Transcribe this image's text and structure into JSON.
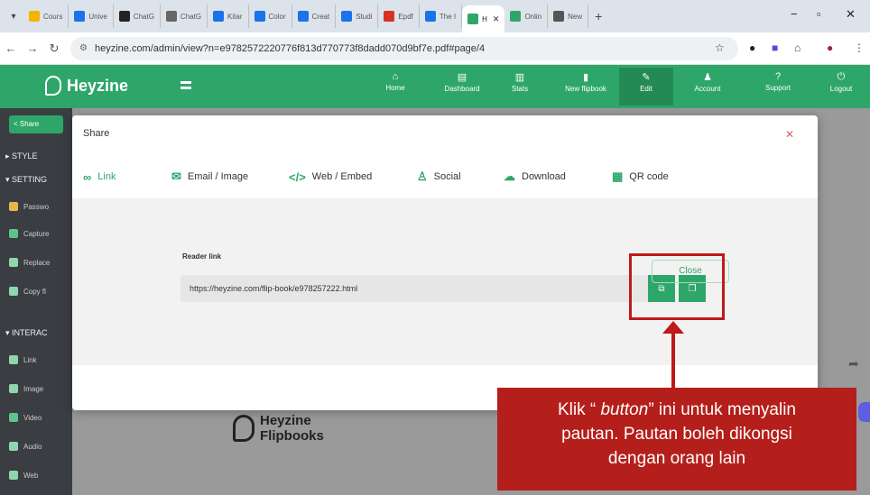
{
  "browser": {
    "tabs": [
      {
        "label": "Cours",
        "color": "#f4b400"
      },
      {
        "label": "Unive",
        "color": "#1a73e8"
      },
      {
        "label": "ChatG",
        "color": "#222222"
      },
      {
        "label": "ChatG",
        "color": "#666666"
      },
      {
        "label": "Kitar",
        "color": "#1a73e8"
      },
      {
        "label": "Color",
        "color": "#1a73e8"
      },
      {
        "label": "Creat",
        "color": "#1a73e8"
      },
      {
        "label": "Studi",
        "color": "#1a73e8"
      },
      {
        "label": "Epdf",
        "color": "#d93025"
      },
      {
        "label": "The I",
        "color": "#1a73e8"
      },
      {
        "label": "H",
        "color": "#2ea66a",
        "active": true
      },
      {
        "label": "Onlin",
        "color": "#2ea66a"
      },
      {
        "label": "New",
        "color": "#555555"
      }
    ],
    "url": "heyzine.com/admin/view?n=e9782572220776f813d770773f8dadd070d9bf7e.pdf#page/4"
  },
  "app": {
    "brand": "Heyzine",
    "nav": [
      {
        "label": "Home",
        "icon": "home-icon"
      },
      {
        "label": "Dashboard",
        "icon": "dashboard-icon"
      },
      {
        "label": "Stats",
        "icon": "stats-icon"
      },
      {
        "label": "New flipbook",
        "icon": "new-file-icon"
      },
      {
        "label": "Edit",
        "icon": "pencil-icon",
        "active": true
      },
      {
        "label": "Account",
        "icon": "user-icon"
      },
      {
        "label": "Support",
        "icon": "question-icon"
      },
      {
        "label": "Logout",
        "icon": "power-icon"
      }
    ],
    "accent": "#2ea66a"
  },
  "sidebar": {
    "share_label": "Share",
    "style_heading": "STYLE",
    "settings_heading": "SETTING",
    "settings_items": [
      "Passwo",
      "Capture",
      "Replace",
      "Copy fl"
    ],
    "interactive_heading": "INTERAC",
    "interactive_items": [
      "Link",
      "Image",
      "Video",
      "Audio",
      "Web"
    ]
  },
  "modal": {
    "title": "Share",
    "tabs": [
      "Link",
      "Email / Image",
      "Web / Embed",
      "Social",
      "Download",
      "QR code"
    ],
    "reader_label": "Reader link",
    "reader_url": "https://heyzine.com/flip-book/e978257222.html",
    "close_label": "Close"
  },
  "footer_brand": {
    "line1": "Heyzine",
    "line2": "Flipbooks"
  },
  "annotation": {
    "prefix": "Klik  “ ",
    "emphasis": "button",
    "suffix": "” ini untuk menyalin",
    "line2": "pautan. Pautan boleh dikongsi",
    "line3": "dengan orang lain",
    "color": "#b41f1b"
  }
}
